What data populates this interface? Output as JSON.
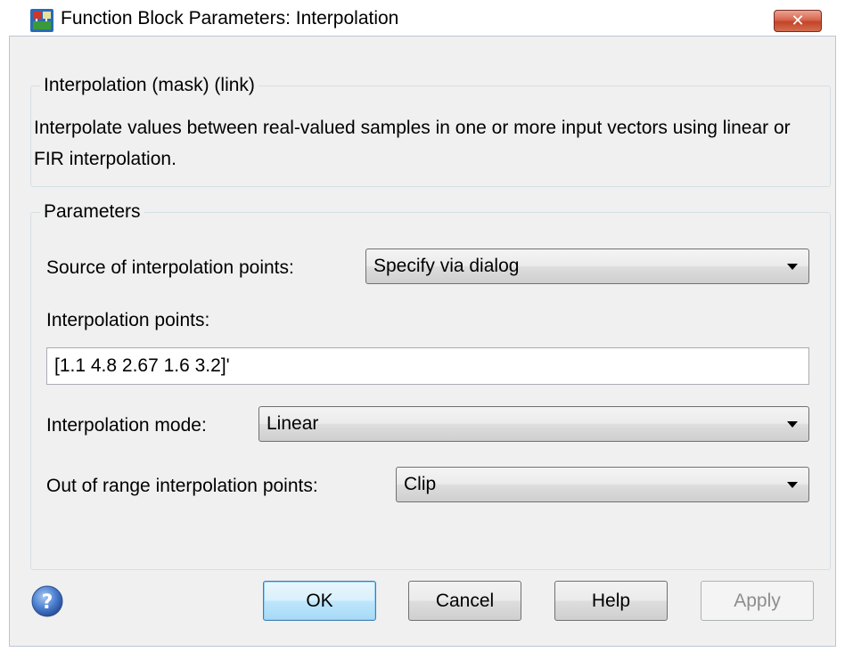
{
  "window": {
    "title": "Function Block Parameters: Interpolation",
    "close_label": "✕"
  },
  "mask_group": {
    "legend": "Interpolation (mask) (link)",
    "description": "Interpolate values between real-valued samples in one or more input vectors using linear or FIR interpolation."
  },
  "params_group": {
    "legend": "Parameters",
    "source_label": "Source of interpolation points:",
    "source_value": "Specify via dialog",
    "points_label": "Interpolation points:",
    "points_value": "[1.1 4.8 2.67 1.6 3.2]'",
    "mode_label": "Interpolation mode:",
    "mode_value": "Linear",
    "range_label": "Out of range interpolation points:",
    "range_value": "Clip"
  },
  "buttons": {
    "ok": "OK",
    "cancel": "Cancel",
    "help": "Help",
    "apply": "Apply"
  },
  "icons": {
    "app": "simulink-block-icon",
    "help": "help-question-icon",
    "dropdown": "chevron-down-icon"
  },
  "colors": {
    "close_button": "#c44425",
    "default_button_border": "#3c7fb1",
    "disabled_text": "#8d8d8d"
  }
}
